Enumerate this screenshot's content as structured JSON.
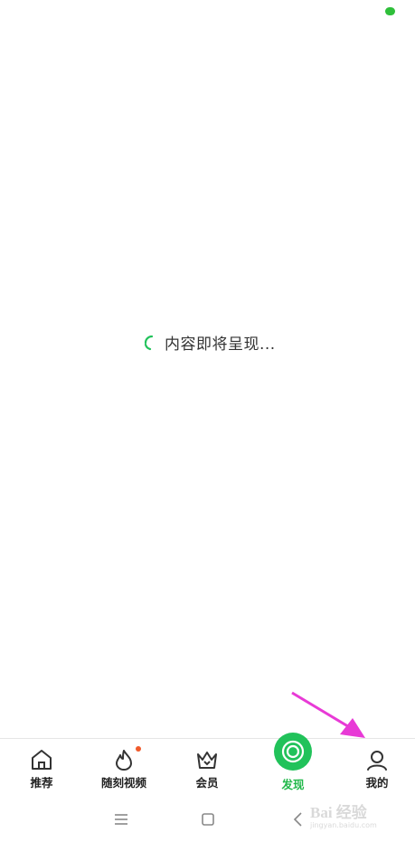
{
  "status": {
    "indicator_color": "#2fbf3a"
  },
  "loading": {
    "text": "内容即将呈现..."
  },
  "tabbar": {
    "accent": "#21b84a",
    "tabs": [
      {
        "label": "推荐",
        "icon": "home-icon"
      },
      {
        "label": "随刻视频",
        "icon": "flame-icon",
        "badge": true
      },
      {
        "label": "会员",
        "icon": "crown-icon"
      },
      {
        "label": "发现",
        "icon": "discover-icon",
        "active": true
      },
      {
        "label": "我的",
        "icon": "profile-icon"
      }
    ]
  },
  "system_nav": {
    "buttons": [
      "menu-icon",
      "home-square-icon",
      "back-icon"
    ]
  },
  "watermark": {
    "main": "Bai 经验",
    "sub": "jingyan.baidu.com"
  }
}
